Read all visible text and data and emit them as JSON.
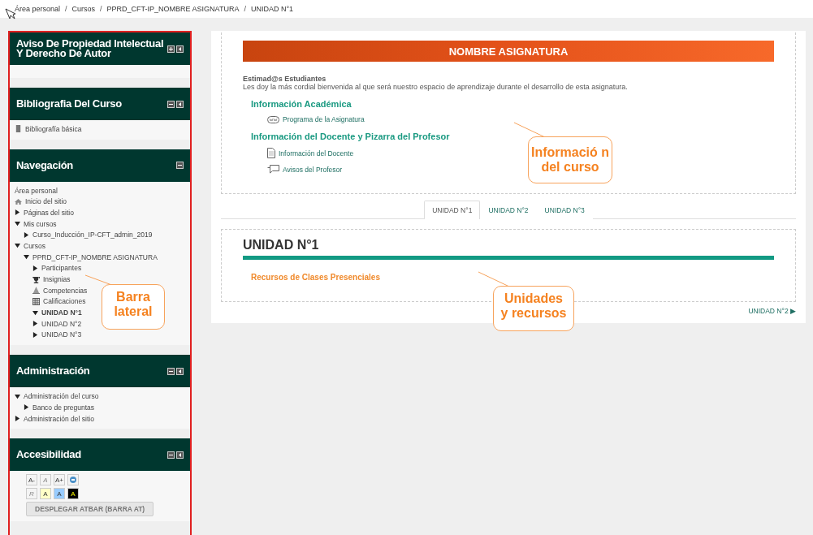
{
  "breadcrumb": {
    "separator": "/",
    "items": [
      "Área personal",
      "Cursos",
      "PPRD_CFT-IP_NOMBRE ASIGNATURA",
      "UNIDAD N°1"
    ]
  },
  "sidebar": {
    "blocks": [
      {
        "kind": "empty",
        "title": "Aviso De Propiedad Intelectual Y Derecho De Autor",
        "controls": [
          {
            "kind": "add"
          },
          {
            "kind": "dock"
          }
        ]
      },
      {
        "kind": "links",
        "title": "Bibliografia Del Curso",
        "controls": [
          {
            "kind": "hide"
          },
          {
            "kind": "dock"
          }
        ],
        "items": [
          "Bibliografía básica"
        ]
      },
      {
        "kind": "tree",
        "title": "Navegación",
        "controls": [
          {
            "kind": "hide"
          }
        ],
        "items": [
          {
            "kind": "leaf",
            "label": "Área personal",
            "current": false
          },
          {
            "kind": "home",
            "label": "Inicio del sitio",
            "current": false
          },
          {
            "kind": "branch",
            "label": "Páginas del sitio",
            "expanded": false,
            "current": false
          },
          {
            "kind": "branch",
            "label": "Mis cursos",
            "expanded": true,
            "current": false,
            "children": [
              {
                "kind": "branch",
                "label": "Curso_Inducción_IP-CFT_admin_2019",
                "expanded": false,
                "current": false
              }
            ]
          },
          {
            "kind": "branch",
            "label": "Cursos",
            "expanded": true,
            "current": false,
            "children": [
              {
                "kind": "branch",
                "label": "PPRD_CFT-IP_NOMBRE ASIGNATURA",
                "expanded": true,
                "current": false,
                "children": [
                  {
                    "kind": "branch",
                    "label": "Participantes",
                    "expanded": false,
                    "current": false
                  },
                  {
                    "kind": "trophy",
                    "label": "Insignias",
                    "current": false
                  },
                  {
                    "kind": "scale",
                    "label": "Competencias",
                    "current": false
                  },
                  {
                    "kind": "grid",
                    "label": "Calificaciones",
                    "current": false
                  },
                  {
                    "kind": "branch",
                    "label": "UNIDAD N°1",
                    "expanded": true,
                    "current": true
                  },
                  {
                    "kind": "branch",
                    "label": "UNIDAD N°2",
                    "expanded": false,
                    "current": false
                  },
                  {
                    "kind": "branch",
                    "label": "UNIDAD N°3",
                    "expanded": false,
                    "current": false
                  }
                ]
              }
            ]
          }
        ]
      },
      {
        "kind": "tree",
        "title": "Administración",
        "controls": [
          {
            "kind": "hide"
          },
          {
            "kind": "dock"
          }
        ],
        "items": [
          {
            "kind": "branch",
            "label": "Administración del curso",
            "expanded": true,
            "current": false,
            "children": [
              {
                "kind": "branch",
                "label": "Banco de preguntas",
                "expanded": false,
                "current": false
              }
            ]
          },
          {
            "kind": "branch",
            "label": "Administración del sitio",
            "expanded": false,
            "current": false
          }
        ]
      },
      {
        "kind": "access",
        "title": "Accesibilidad",
        "controls": [
          {
            "kind": "hide"
          },
          {
            "kind": "dock"
          }
        ],
        "rows": [
          [
            {
              "kind": "text",
              "label": "A-",
              "disabled": false,
              "color": "#f4f4f4"
            },
            {
              "kind": "text",
              "label": "A",
              "disabled": true,
              "color": "#f4f4f4"
            },
            {
              "kind": "text",
              "label": "A+",
              "disabled": false,
              "color": "#f4f4f4"
            },
            {
              "kind": "icon",
              "disabled": false,
              "color": "#f4f4f4"
            }
          ],
          [
            {
              "kind": "text",
              "label": "R",
              "disabled": true,
              "color": "#f4f4f4"
            },
            {
              "kind": "text",
              "label": "A",
              "disabled": false,
              "color": "#ffffc8"
            },
            {
              "kind": "text",
              "label": "A",
              "disabled": false,
              "color": "#99ccff"
            },
            {
              "kind": "text",
              "label": "A",
              "disabled": false,
              "color": "#000000"
            }
          ]
        ],
        "wide_button": "DESPLEGAR ATBAR (BARRA AT)"
      }
    ]
  },
  "course": {
    "banner": "NOMBRE ASIGNATURA",
    "greeting": "Estimad@s Estudiantes",
    "welcome": "Les doy la más cordial bienvenida al que será nuestro espacio de aprendizaje durante el desarrollo de esta asignatura.",
    "sections": [
      {
        "heading": "Información Académica",
        "resources": [
          {
            "kind": "url",
            "label": "Programa de la Asignatura"
          }
        ]
      },
      {
        "heading": "Información del Docente y Pizarra del Profesor",
        "resources": [
          {
            "kind": "page",
            "label": "Información del Docente"
          },
          {
            "kind": "forum",
            "label": "Avisos del Profesor"
          }
        ]
      }
    ]
  },
  "tabs": [
    {
      "label": "UNIDAD N°1",
      "selected": true
    },
    {
      "label": "UNIDAD N°2",
      "selected": false
    },
    {
      "label": "UNIDAD N°3",
      "selected": false
    }
  ],
  "unit": {
    "title": "UNIDAD N°1",
    "resource": "Recursos de Clases Presenciales",
    "next": "UNIDAD N°2 ▶"
  },
  "callouts": [
    {
      "text": "Barra lateral"
    },
    {
      "text": "Informació n del curso"
    },
    {
      "text": "Unidades y recursos"
    }
  ]
}
